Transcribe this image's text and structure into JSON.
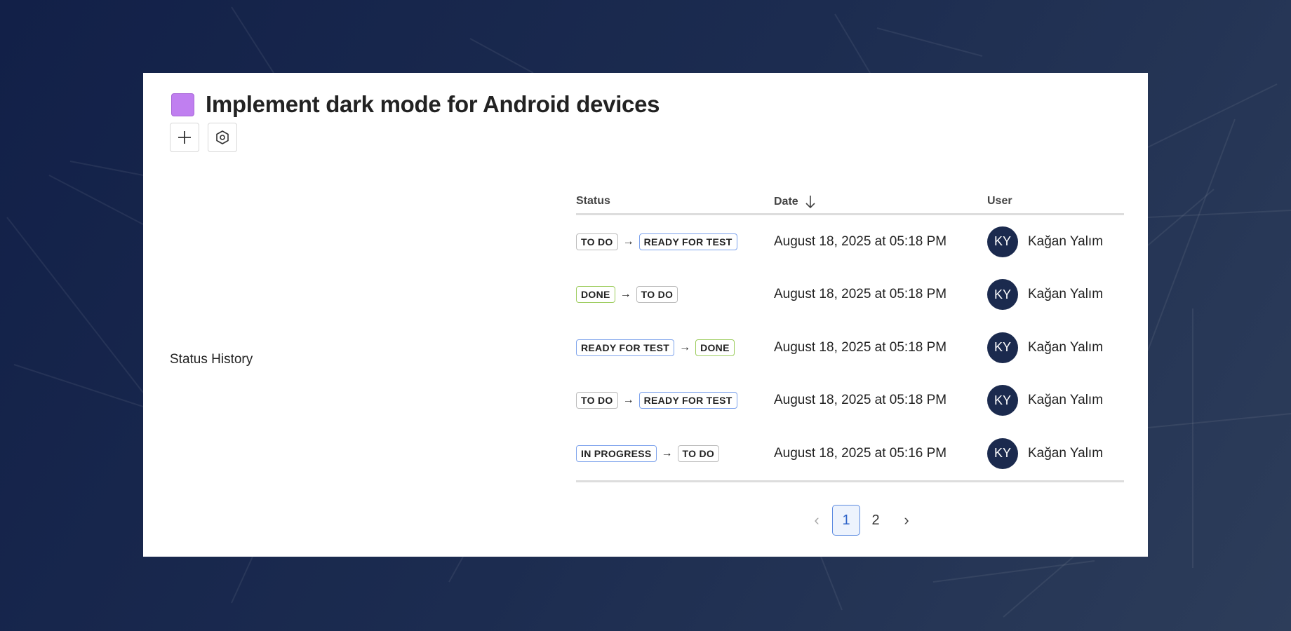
{
  "task": {
    "title": "Implement dark mode for Android devices",
    "color": "#c07ff0"
  },
  "toolbar": {
    "add_icon": "plus-icon",
    "settings_icon": "hexagon-settings-icon"
  },
  "section_label": "Status History",
  "table": {
    "headers": {
      "status": "Status",
      "date": "Date",
      "user": "User"
    },
    "rows": [
      {
        "from": "TO DO",
        "from_color": "#bbbbbb",
        "to": "READY FOR TEST",
        "to_color": "#7ea3ec",
        "date": "August 18, 2025 at 05:18 PM",
        "initials": "KY",
        "user": "Kağan Yalım"
      },
      {
        "from": "DONE",
        "from_color": "#9ccc5c",
        "to": "TO DO",
        "to_color": "#bbbbbb",
        "date": "August 18, 2025 at 05:18 PM",
        "initials": "KY",
        "user": "Kağan Yalım"
      },
      {
        "from": "READY FOR TEST",
        "from_color": "#7ea3ec",
        "to": "DONE",
        "to_color": "#9ccc5c",
        "date": "August 18, 2025 at 05:18 PM",
        "initials": "KY",
        "user": "Kağan Yalım"
      },
      {
        "from": "TO DO",
        "from_color": "#bbbbbb",
        "to": "READY FOR TEST",
        "to_color": "#7ea3ec",
        "date": "August 18, 2025 at 05:18 PM",
        "initials": "KY",
        "user": "Kağan Yalım"
      },
      {
        "from": "IN PROGRESS",
        "from_color": "#7ea3ec",
        "to": "TO DO",
        "to_color": "#bbbbbb",
        "date": "August 18, 2025 at 05:16 PM",
        "initials": "KY",
        "user": "Kağan Yalım"
      }
    ]
  },
  "pagination": {
    "prev": "‹",
    "pages": [
      "1",
      "2"
    ],
    "current": "1",
    "next": "›"
  }
}
